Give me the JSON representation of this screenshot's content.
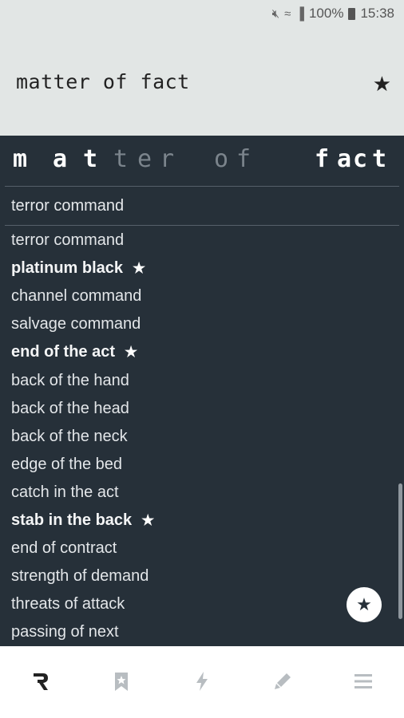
{
  "status_bar": {
    "icons": [
      "mute-icon",
      "wifi-icon",
      "signal-icon",
      "battery-icon"
    ],
    "battery": "100%",
    "time": "15:38"
  },
  "header": {
    "title": "matter of fact",
    "star_icon": "star-icon"
  },
  "spaced_word": {
    "letters": [
      {
        "char": "m",
        "active": true
      },
      {
        "char": "a",
        "active": true
      },
      {
        "char": "t",
        "active": true
      },
      {
        "char": "t",
        "active": false
      },
      {
        "char": "e",
        "active": false
      },
      {
        "char": "r",
        "active": false
      },
      {
        "char": "o",
        "active": false
      },
      {
        "char": "f",
        "active": false
      },
      {
        "char": "f",
        "active": true
      },
      {
        "char": "a",
        "active": true
      },
      {
        "char": "c",
        "active": true
      },
      {
        "char": "t",
        "active": true
      }
    ]
  },
  "search": {
    "value": "terror command"
  },
  "results": [
    {
      "text": "terror command",
      "favorite": false
    },
    {
      "text": "platinum black",
      "favorite": true
    },
    {
      "text": "channel command",
      "favorite": false
    },
    {
      "text": "salvage command",
      "favorite": false
    },
    {
      "text": "end of the act",
      "favorite": true
    },
    {
      "text": "back of the hand",
      "favorite": false
    },
    {
      "text": "back of the head",
      "favorite": false
    },
    {
      "text": "back of the neck",
      "favorite": false
    },
    {
      "text": "edge of the bed",
      "favorite": false
    },
    {
      "text": "catch in the act",
      "favorite": false
    },
    {
      "text": "stab in the back",
      "favorite": true
    },
    {
      "text": "end of contract",
      "favorite": false
    },
    {
      "text": "strength of demand",
      "favorite": false
    },
    {
      "text": "threats of attack",
      "favorite": false
    },
    {
      "text": "passing of next",
      "favorite": false
    }
  ],
  "fab_icon": "star-icon",
  "bottom_nav": [
    {
      "icon": "rhyme-logo-icon",
      "active": true
    },
    {
      "icon": "bookmark-star-icon",
      "active": false
    },
    {
      "icon": "lightning-icon",
      "active": false
    },
    {
      "icon": "pencil-icon",
      "active": false
    },
    {
      "icon": "menu-icon",
      "active": false
    }
  ],
  "colors": {
    "background": "#263039",
    "header_bg": "#e2e6e5",
    "active_nav": "#222222",
    "inactive_nav": "#b8bdc1"
  }
}
